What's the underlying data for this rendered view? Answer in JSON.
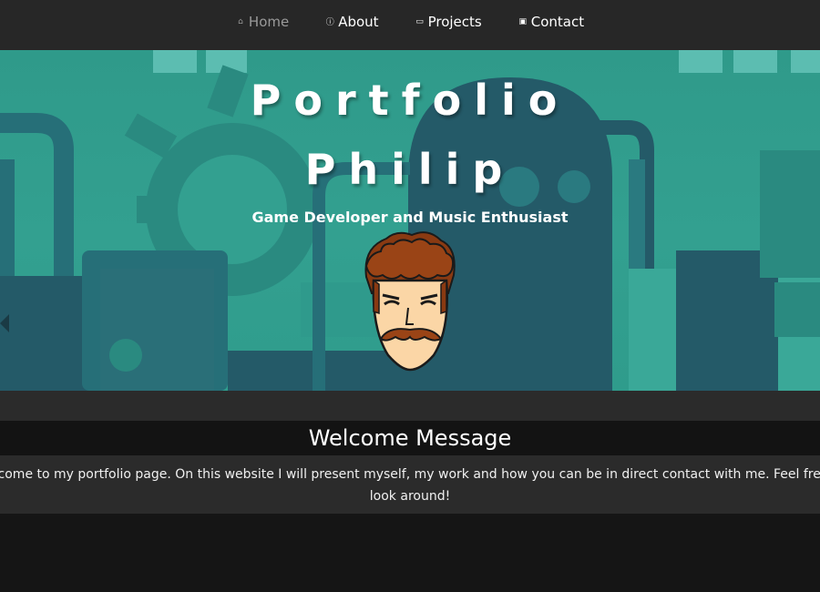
{
  "nav": {
    "items": [
      {
        "label": "Home",
        "icon": "home-icon",
        "active": true
      },
      {
        "label": "About",
        "icon": "info-icon",
        "active": false
      },
      {
        "label": "Projects",
        "icon": "folder-icon",
        "active": false
      },
      {
        "label": "Contact",
        "icon": "contact-card-icon",
        "active": false
      }
    ]
  },
  "hero": {
    "title_line1": "Portfolio",
    "title_line2": "Philip",
    "subtitle": "Game Developer and Music Enthusiast",
    "avatar_icon": "cartoon-avatar-icon"
  },
  "welcome": {
    "heading": "Welcome Message",
    "body": "Welcome to my portfolio page. On this website I will present myself, my work and how you can be in direct contact with me. Feel free to look around!"
  },
  "colors": {
    "nav_bg": "#272727",
    "hero_teal": "#33a090",
    "hero_dark": "#245a68",
    "page_bg": "#151515",
    "panel_bg": "#2b2b2b"
  }
}
